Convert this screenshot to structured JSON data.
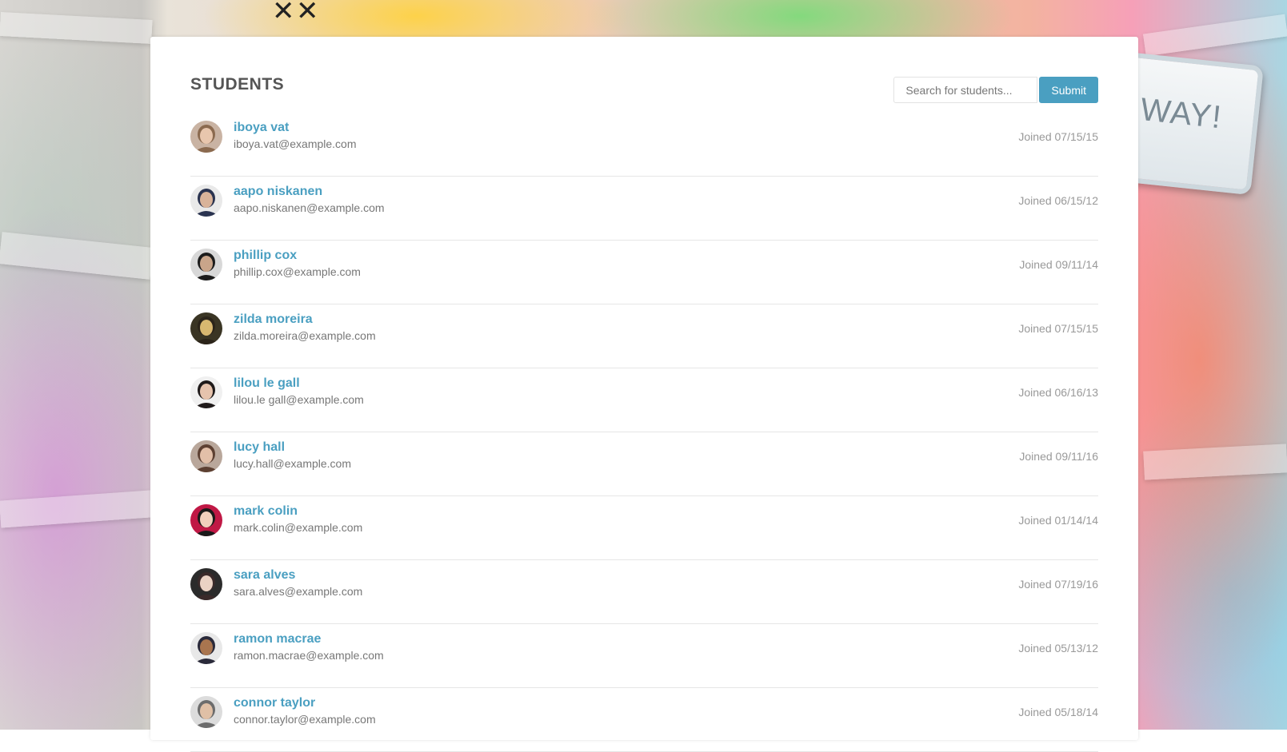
{
  "page": {
    "title": "STUDENTS",
    "background_sign_text": "S WAY!"
  },
  "search": {
    "placeholder": "Search for students...",
    "submit_label": "Submit"
  },
  "colors": {
    "accent": "#4a9fc1",
    "title": "#555555",
    "email": "#777777",
    "joined": "#999999"
  },
  "students": [
    {
      "name": "iboya vat",
      "email": "iboya.vat@example.com",
      "joined": "Joined 07/15/15",
      "avatar_bg": "#c9b3a3",
      "avatar_skin": "#e8c6ad",
      "avatar_hair": "#8b6a4f"
    },
    {
      "name": "aapo niskanen",
      "email": "aapo.niskanen@example.com",
      "joined": "Joined 06/15/12",
      "avatar_bg": "#e9e9e9",
      "avatar_skin": "#d9b39a",
      "avatar_hair": "#2a3350"
    },
    {
      "name": "phillip cox",
      "email": "phillip.cox@example.com",
      "joined": "Joined 09/11/14",
      "avatar_bg": "#d8d8d8",
      "avatar_skin": "#c9a58a",
      "avatar_hair": "#1c1c1c"
    },
    {
      "name": "zilda moreira",
      "email": "zilda.moreira@example.com",
      "joined": "Joined 07/15/15",
      "avatar_bg": "#3a3524",
      "avatar_skin": "#d8b870",
      "avatar_hair": "#2b241a"
    },
    {
      "name": "lilou le gall",
      "email": "lilou.le gall@example.com",
      "joined": "Joined 06/16/13",
      "avatar_bg": "#f0f0f0",
      "avatar_skin": "#e6c3ad",
      "avatar_hair": "#1f1a1a"
    },
    {
      "name": "lucy hall",
      "email": "lucy.hall@example.com",
      "joined": "Joined 09/11/16",
      "avatar_bg": "#b9a79b",
      "avatar_skin": "#e2bfa8",
      "avatar_hair": "#5d4032"
    },
    {
      "name": "mark colin",
      "email": "mark.colin@example.com",
      "joined": "Joined 01/14/14",
      "avatar_bg": "#c01845",
      "avatar_skin": "#f1cfbc",
      "avatar_hair": "#1a1a1a"
    },
    {
      "name": "sara alves",
      "email": "sara.alves@example.com",
      "joined": "Joined 07/19/16",
      "avatar_bg": "#2b2b2b",
      "avatar_skin": "#ead2c4",
      "avatar_hair": "#3a2a2a"
    },
    {
      "name": "ramon macrae",
      "email": "ramon.macrae@example.com",
      "joined": "Joined 05/13/12",
      "avatar_bg": "#e8e8e8",
      "avatar_skin": "#a9754f",
      "avatar_hair": "#2a2a3a"
    },
    {
      "name": "connor taylor",
      "email": "connor.taylor@example.com",
      "joined": "Joined 05/18/14",
      "avatar_bg": "#dcdcdc",
      "avatar_skin": "#e0c0a6",
      "avatar_hair": "#6c6c6c"
    }
  ]
}
